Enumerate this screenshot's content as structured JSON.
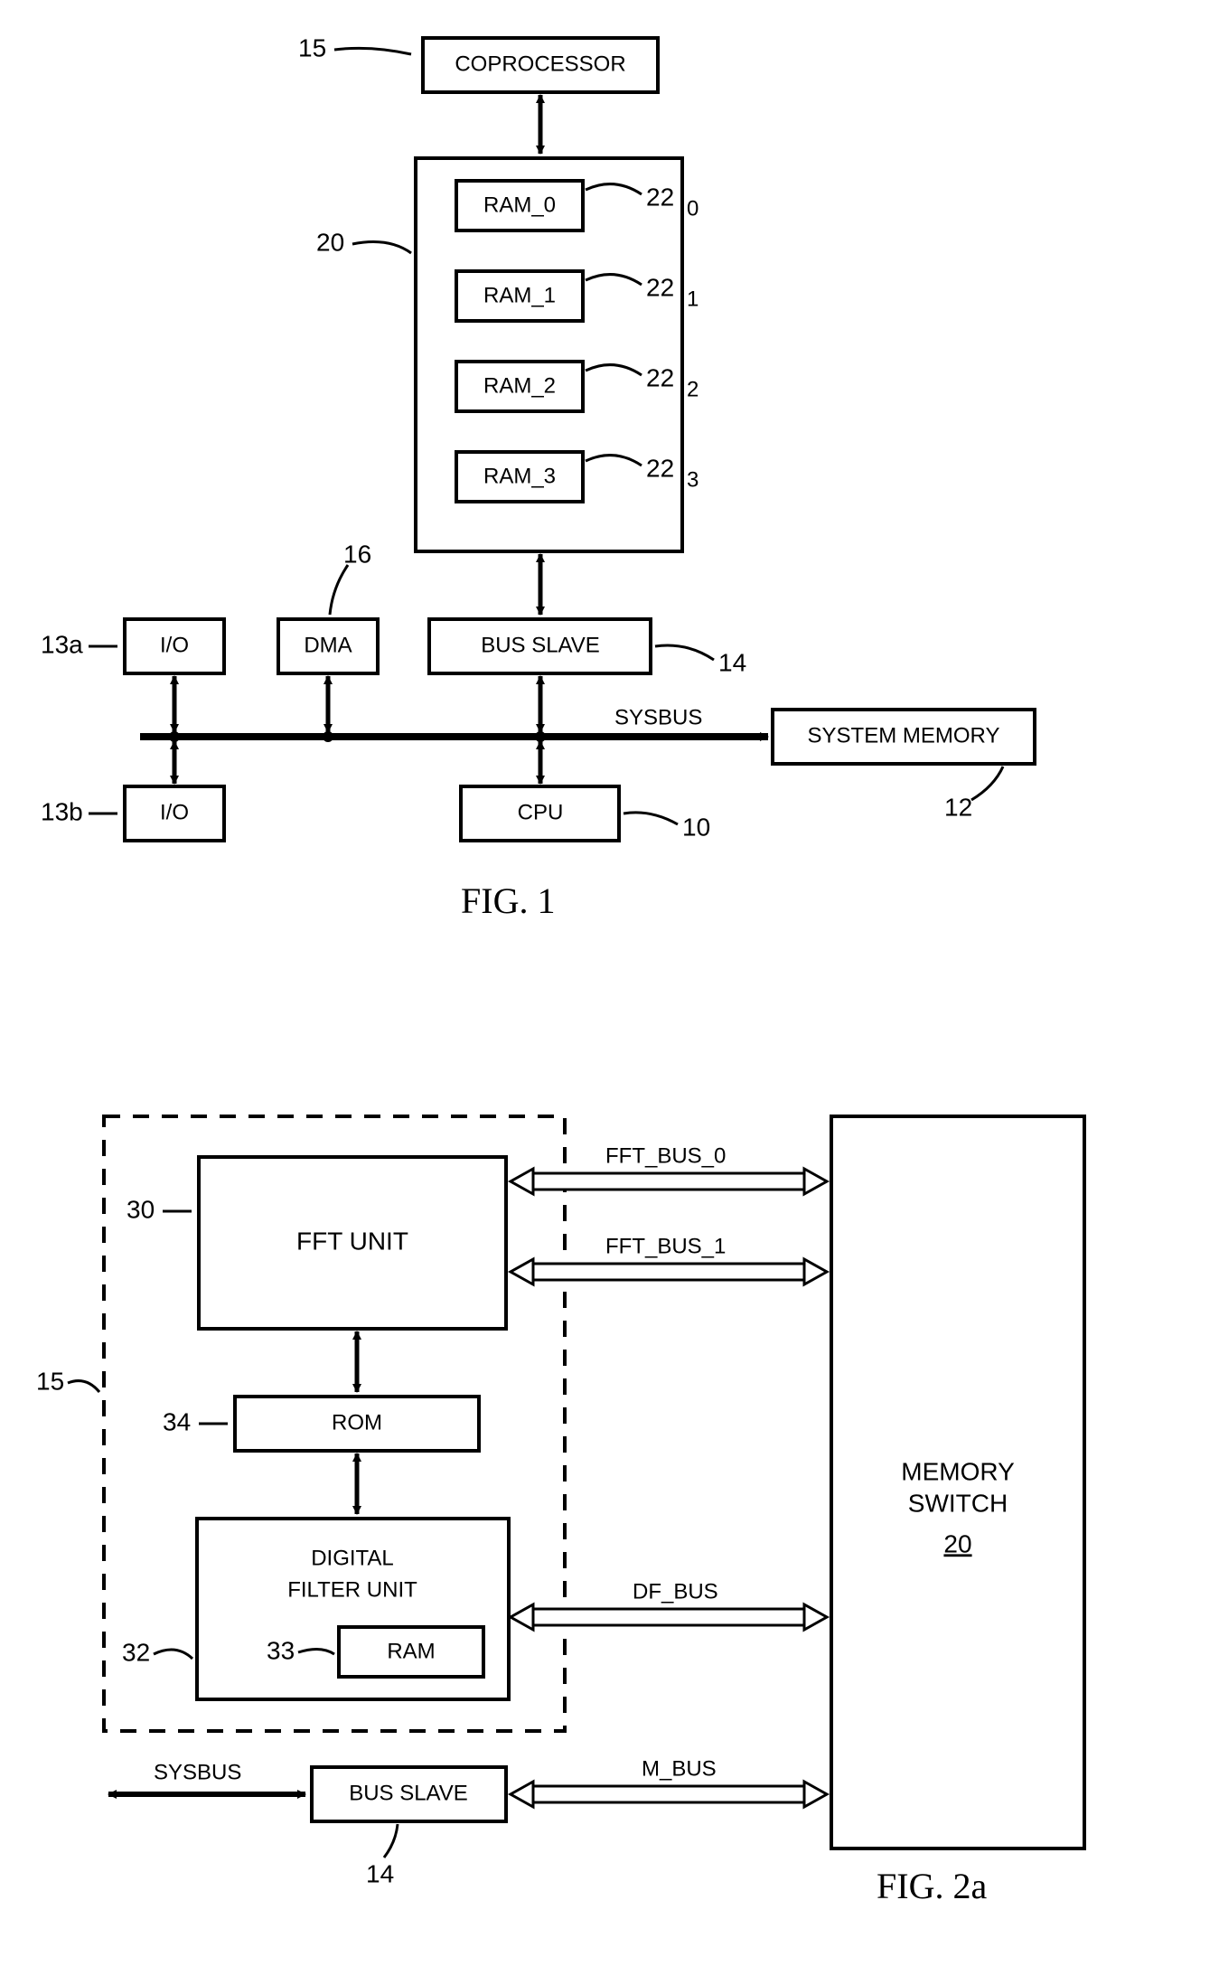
{
  "fig1": {
    "caption": "FIG. 1",
    "blocks": {
      "coprocessor": "COPROCESSOR",
      "ram0": "RAM_0",
      "ram1": "RAM_1",
      "ram2": "RAM_2",
      "ram3": "RAM_3",
      "io_a": "I/O",
      "io_b": "I/O",
      "dma": "DMA",
      "bus_slave": "BUS SLAVE",
      "cpu": "CPU",
      "system_memory": "SYSTEM MEMORY",
      "sysbus": "SYSBUS"
    },
    "refs": {
      "coprocessor": "15",
      "memswitch": "20",
      "ram0": "22",
      "ram0_sub": "0",
      "ram1": "22",
      "ram1_sub": "1",
      "ram2": "22",
      "ram2_sub": "2",
      "ram3": "22",
      "ram3_sub": "3",
      "io_a": "13a",
      "io_b": "13b",
      "dma": "16",
      "bus_slave": "14",
      "cpu": "10",
      "system_memory": "12"
    }
  },
  "fig2a": {
    "caption": "FIG. 2a",
    "blocks": {
      "fft_unit": "FFT UNIT",
      "rom": "ROM",
      "digital_filter_unit_l1": "DIGITAL",
      "digital_filter_unit_l2": "FILTER UNIT",
      "ram": "RAM",
      "memory_switch_l1": "MEMORY",
      "memory_switch_l2": "SWITCH",
      "memory_switch_ref": "20",
      "bus_slave": "BUS SLAVE"
    },
    "bus_labels": {
      "fft0": "FFT_BUS_0",
      "fft1": "FFT_BUS_1",
      "df": "DF_BUS",
      "m": "M_BUS",
      "sys": "SYSBUS"
    },
    "refs": {
      "coprocessor": "15",
      "fft": "30",
      "rom": "34",
      "dfu": "32",
      "ram": "33",
      "bus_slave": "14"
    }
  }
}
